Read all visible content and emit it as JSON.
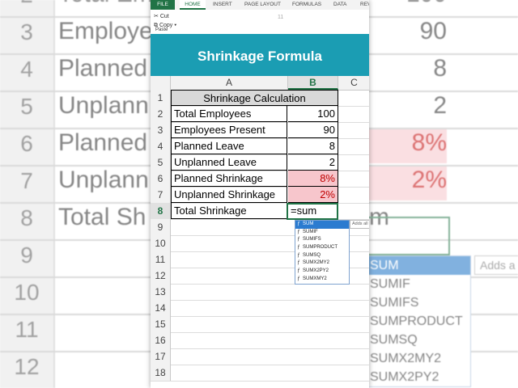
{
  "ribbon": {
    "tabs": [
      "FILE",
      "HOME",
      "INSERT",
      "PAGE LAYOUT",
      "FORMULAS",
      "DATA",
      "REV"
    ],
    "cut_label": "Cut",
    "copy_label": "Copy",
    "paste_label": "Paste",
    "font_size": "11"
  },
  "banner": {
    "title": "Shrinkage Formula"
  },
  "columns": [
    "A",
    "B",
    "C"
  ],
  "table": {
    "title": "Shrinkage Calculation",
    "rows": [
      {
        "num": "2",
        "label": "Total Employees",
        "value": "100"
      },
      {
        "num": "3",
        "label": "Employees Present",
        "value": "90"
      },
      {
        "num": "4",
        "label": "Planned Leave",
        "value": "8"
      },
      {
        "num": "5",
        "label": "Unplanned Leave",
        "value": "2"
      },
      {
        "num": "6",
        "label": "Planned Shrinkage",
        "value": "8%"
      },
      {
        "num": "7",
        "label": "Unplanned Shrinkage",
        "value": "2%"
      },
      {
        "num": "8",
        "label": "Total Shrinkage",
        "value": "=sum"
      }
    ],
    "empty_rows": [
      "9",
      "10",
      "11",
      "12",
      "13",
      "14",
      "15",
      "16",
      "17",
      "18"
    ]
  },
  "autocomplete": {
    "items": [
      "SUM",
      "SUMIF",
      "SUMIFS",
      "SUMPRODUCT",
      "SUMSQ",
      "SUMX2MY2",
      "SUMX2PY2",
      "SUMXMY2"
    ],
    "tooltip": "Adds all the numbers in a range of cells"
  },
  "background": {
    "rows": [
      {
        "num": "2",
        "label": "Total Em",
        "value": "100"
      },
      {
        "num": "3",
        "label": "Employe",
        "value": "90"
      },
      {
        "num": "4",
        "label": "Planned",
        "value": "8"
      },
      {
        "num": "5",
        "label": "Unplann",
        "value": "2"
      },
      {
        "num": "6",
        "label": "Planned",
        "value": "8%"
      },
      {
        "num": "7",
        "label": "Unplann",
        "value": "2%"
      },
      {
        "num": "8",
        "label": "Total Sh",
        "value": "m"
      },
      {
        "num": "9",
        "label": "",
        "value": ""
      },
      {
        "num": "10",
        "label": "",
        "value": ""
      },
      {
        "num": "11",
        "label": "",
        "value": ""
      },
      {
        "num": "12",
        "label": "",
        "value": ""
      }
    ],
    "ac_items": [
      "SUM",
      "SUMIF",
      "SUMIFS",
      "SUMPRODUCT",
      "SUMSQ",
      "SUMX2MY2",
      "SUMX2PY2"
    ],
    "tooltip": "Adds a"
  },
  "colors": {
    "excel_green": "#217346",
    "banner": "#1b9db3",
    "pink_fill": "#f7c6cc",
    "red_text": "#c00000",
    "ac_selected": "#2b7bd0"
  }
}
